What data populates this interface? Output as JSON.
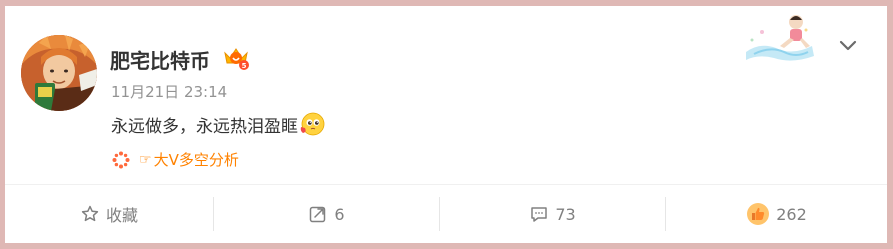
{
  "post": {
    "username": "肥宅比特币",
    "timestamp": "11月21日 23:14",
    "text": "永远做多，永远热泪盈眶",
    "emoji_icon": "moved-to-tears-emoji",
    "source_link": {
      "prefix": "☞",
      "label": "大V多空分析",
      "icon": "spark-icon"
    },
    "badge_icon": "vip-badge-icon",
    "menu_icon": "chevron-down-icon"
  },
  "toolbar": {
    "favorite_label": "收藏",
    "repost_count": "6",
    "comment_count": "73",
    "like_count": "262"
  },
  "colors": {
    "accent": "#ff8200",
    "username": "#333333",
    "muted": "#939393",
    "border": "#dfb8b5"
  }
}
